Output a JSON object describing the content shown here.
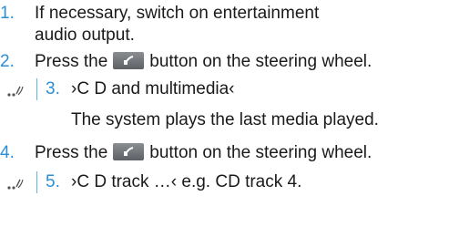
{
  "steps": [
    {
      "number": "1.",
      "text": "If necessary, switch on entertainment audio output."
    },
    {
      "number": "2.",
      "before": "Press the",
      "after": "button on the steering wheel."
    },
    {
      "number": "3.",
      "text": "›C D and multimedia‹",
      "note": "The system plays the last media played."
    },
    {
      "number": "4.",
      "before": "Press the",
      "after": "button on the steering wheel."
    },
    {
      "number": "5.",
      "text": "›C D track …‹ e.g. CD track 4."
    }
  ],
  "icons": {
    "voice": "voice-command-icon",
    "button": "steering-wheel-voice-button-icon"
  },
  "colors": {
    "accent": "#2b8fd6"
  }
}
